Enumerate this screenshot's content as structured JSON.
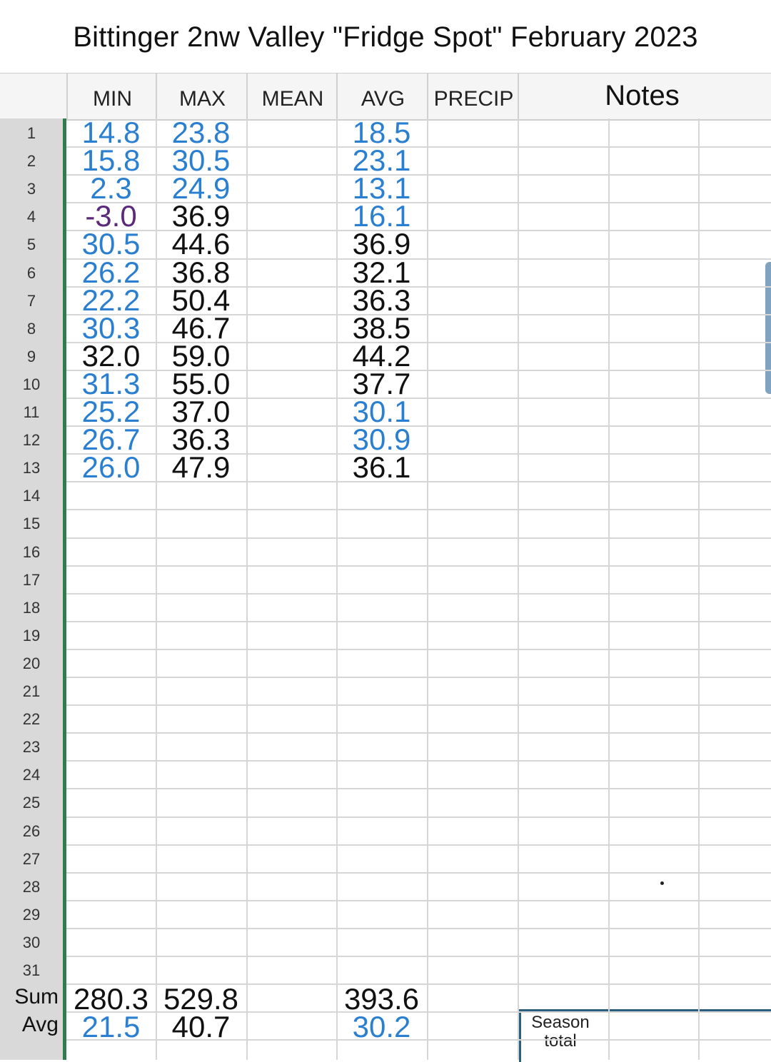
{
  "title": "Bittinger 2nw Valley \"Fridge Spot\" February 2023",
  "columns": {
    "min": "MIN",
    "max": "MAX",
    "mean": "MEAN",
    "avg": "AVG",
    "precip": "PRECIP",
    "notes": "Notes"
  },
  "row_numbers": [
    "1",
    "2",
    "3",
    "4",
    "5",
    "6",
    "7",
    "8",
    "9",
    "10",
    "11",
    "12",
    "13",
    "14",
    "15",
    "16",
    "17",
    "18",
    "19",
    "20",
    "21",
    "22",
    "23",
    "24",
    "25",
    "26",
    "27",
    "28",
    "29",
    "30",
    "31"
  ],
  "rows": [
    {
      "min": "14.8",
      "max": "23.8",
      "avg": "18.5"
    },
    {
      "min": "15.8",
      "max": "30.5",
      "avg": "23.1"
    },
    {
      "min": "2.3",
      "max": "24.9",
      "avg": "13.1"
    },
    {
      "min": "-3.0",
      "max": "36.9",
      "avg": "16.1"
    },
    {
      "min": "30.5",
      "max": "44.6",
      "avg": "36.9"
    },
    {
      "min": "26.2",
      "max": "36.8",
      "avg": "32.1"
    },
    {
      "min": "22.2",
      "max": "50.4",
      "avg": "36.3"
    },
    {
      "min": "30.3",
      "max": "46.7",
      "avg": "38.5"
    },
    {
      "min": "32.0",
      "max": "59.0",
      "avg": "44.2"
    },
    {
      "min": "31.3",
      "max": "55.0",
      "avg": "37.7"
    },
    {
      "min": "25.2",
      "max": "37.0",
      "avg": "30.1"
    },
    {
      "min": "26.7",
      "max": "36.3",
      "avg": "30.9"
    },
    {
      "min": "26.0",
      "max": "47.9",
      "avg": "36.1"
    }
  ],
  "sum": {
    "label": "Sum",
    "min": "280.3",
    "max": "529.8",
    "avg": "393.6"
  },
  "average": {
    "label": "Avg",
    "min": "21.5",
    "max": "40.7",
    "avg": "30.2"
  },
  "season_total_label": "Season total",
  "colors": {
    "cold_blue": "#2a7fd0",
    "below_zero_purple": "#5b2a7a",
    "text_black": "#111111",
    "frozen_bar_green": "#2e7d4f"
  }
}
